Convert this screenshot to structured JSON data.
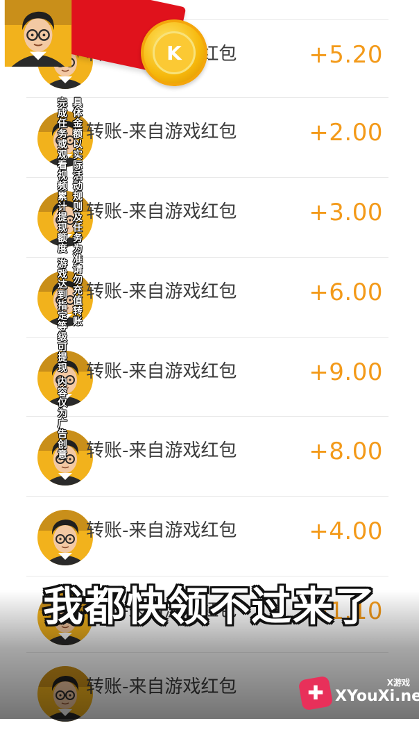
{
  "transactions": [
    {
      "title": "转账-来自游戏红包",
      "amount": "+5.20"
    },
    {
      "title": "转账-来自游戏红包",
      "amount": "+2.00"
    },
    {
      "title": "转账-来自游戏红包",
      "amount": "+3.00"
    },
    {
      "title": "转账-来自游戏红包",
      "amount": "+6.00"
    },
    {
      "title": "转账-来自游戏红包",
      "amount": "+9.00"
    },
    {
      "title": "转账-来自游戏红包",
      "amount": "+8.00"
    },
    {
      "title": "转账-来自游戏红包",
      "amount": "+4.00"
    },
    {
      "title": "转账-来自游戏红包",
      "amount": "+1.10"
    },
    {
      "title": "转账-来自游戏红包",
      "amount": ""
    }
  ],
  "overlay": {
    "coin_label": "K",
    "disclaimer_1": "具体金额以实际活动规则及任务为准",
    "disclaimer_2": "完成任务或观看视频累计提现额度",
    "disclaimer_3": "请勿充值转账",
    "disclaimer_4": "游戏达到指定等级可提现",
    "disclaimer_5": "内容仅为广告创意",
    "caption": "我都快领不过来了"
  },
  "watermark": {
    "tag": "X游戏",
    "site": "XYouXi.net"
  },
  "colors": {
    "amount": "#f39a1a",
    "title": "#3c3c3c",
    "red_envelope": "#e0121c",
    "coin": "#f6b80c"
  },
  "icons": [
    "avatar",
    "red-envelope-icon",
    "gold-coin-icon",
    "xyouxi-logo-icon"
  ]
}
